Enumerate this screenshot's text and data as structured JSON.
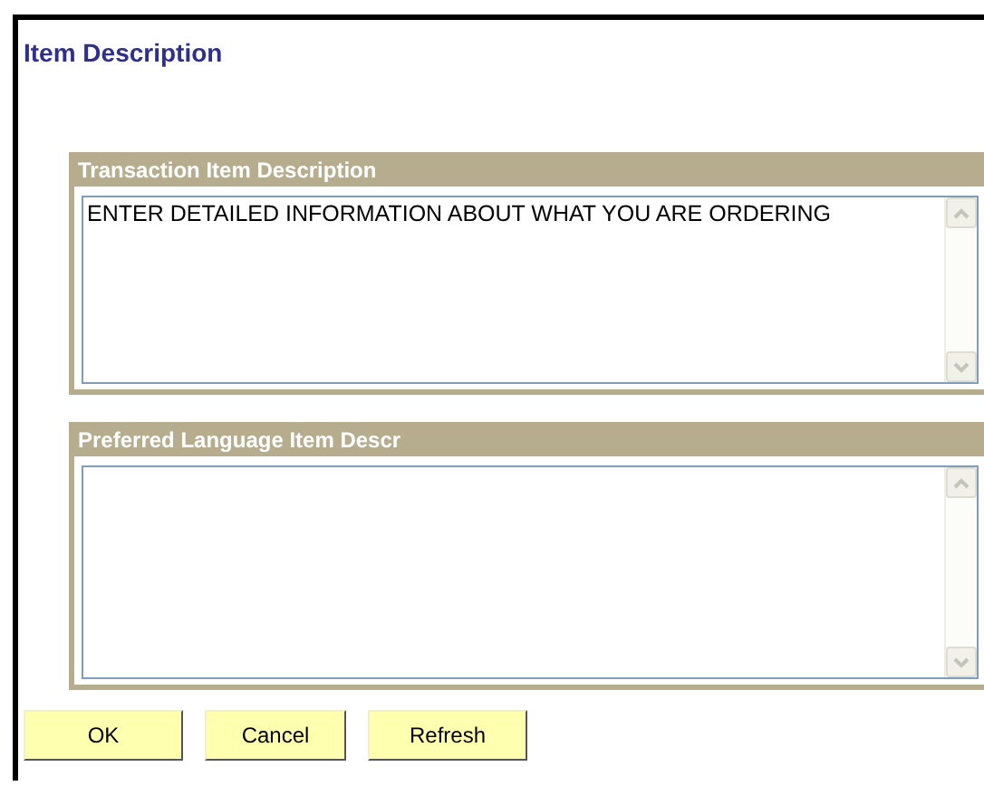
{
  "page": {
    "title": "Item Description"
  },
  "sections": [
    {
      "title": "Transaction Item Description",
      "value": "ENTER DETAILED INFORMATION ABOUT WHAT YOU ARE ORDERING"
    },
    {
      "title": "Preferred Language Item Descr"
    }
  ],
  "buttons": [
    "OK",
    "Cancel",
    "Refresh"
  ]
}
